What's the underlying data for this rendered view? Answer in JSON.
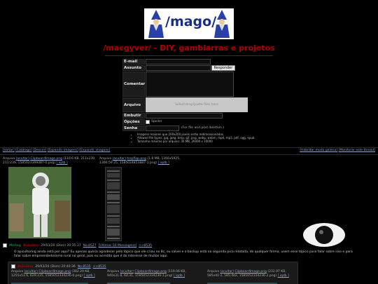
{
  "banner": {
    "text": "/mago/",
    "colors": {
      "background": "#ffffff",
      "wizard": "#2b3fa8"
    }
  },
  "board": {
    "title": "/macgyver/ - DIY, gambiarras e projetos",
    "title_color": "#b00000"
  },
  "form": {
    "labels": {
      "email": "E-mail",
      "subject": "Assunto",
      "comment": "Comentar",
      "file": "Arquivo",
      "embed": "Embutir",
      "options": "Opções",
      "password": "Senha"
    },
    "submit_label": "Responder",
    "dropzone_text": "Select/drop/paste files here",
    "spoiler_label": "Spoiler",
    "password_hint": "(For file and post deletion.)",
    "rules": [
      "Imagens maiores que 200x200 pixels serão redimensionadas.",
      "Allowed file types: jpg, jpeg, bmp, gif, png, webp, webm, mp4, mp3, pdf, ogg, epub.",
      "Tamanho máximo por arquivo: 30 MB, 26000 x 10000"
    ]
  },
  "nav": {
    "left": [
      "[Voltar]",
      "[Catálogo]",
      "[Descer]",
      "[Expandir imagens]",
      "[Expandir imagens]"
    ],
    "right": [
      "[Habilitar modo galeria]",
      "[Monitorar este thread]"
    ]
  },
  "op": {
    "files": [
      {
        "label": "Arquivo",
        "actions": "(ocultar)",
        "name": "ClipboardImage.png",
        "meta": "(110.6 KB, 211x239, 211:239, 1585023399387-0.png)",
        "links": "[ iqdb ]"
      },
      {
        "label": "Arquivo",
        "actions": "(ocultar)",
        "name": "trepflap.png",
        "meta": "(1.8 MB, 1366x5925, 1366:59",
        "meta2": "25, 1585024853887-1.png)",
        "links": "[ iqdb ]"
      }
    ],
    "name": "Mellog",
    "subject": "Anônimo",
    "date": "29/03/20 (Dom) 20:35:37",
    "postnum": "No.8527",
    "reply_link": "[Últimas 50 Mensagens]",
    "backlink": ">>8535",
    "body": "O apicultoring ainda está por aqui? Eu apenas queria agradecer pelo tópico que ele criou no 8c; eu salvei e o backup está na segunda pica relatada, de qualquer forma, usem esse tópico para falar sobre isso e para falar sobre empreendedorismo rural no geral, pois eu acredito que é do interesse de muitos aqui."
  },
  "reply": {
    "name": "Anônimo",
    "date": "29/03/20 (Dom) 20:40:36",
    "postnum": "No.8535",
    "backlink": ">>8535",
    "files": [
      {
        "label": "Arquivo",
        "actions": "(ocultar)",
        "name": "ClipboardImage.png",
        "meta": "(382.29 KB, 1255x53",
        "meta2": "6, 629:235, 1585052334236-0.png)",
        "links": "[ iqdb ]"
      },
      {
        "label": "Arquivo",
        "actions": "(ocultar)",
        "name": "ClipboardImage.png",
        "meta": "(119.06 KB, 940x31",
        "meta2": "8, 64:31, 1585052334236-1.png)",
        "links": "[ iqdb ]"
      },
      {
        "label": "Arquivo",
        "actions": "(ocultar)",
        "name": "ClipboardImage.png",
        "meta": "(232.97 KB, 585x40",
        "meta2": "2, 585:402, 1585052334236-2.png)",
        "links": "[ iqdb ]"
      }
    ]
  },
  "icons": {
    "eye": "eye-icon"
  }
}
